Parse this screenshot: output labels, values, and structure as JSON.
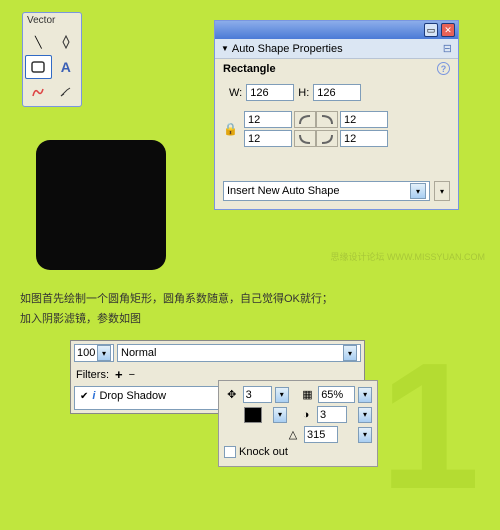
{
  "vector": {
    "title": "Vector"
  },
  "props": {
    "title": "Auto Shape Properties",
    "shape": "Rectangle",
    "w_label": "W:",
    "w": "126",
    "h_label": "H:",
    "h": "126",
    "corners": {
      "tl": "12",
      "tr": "12",
      "bl": "12",
      "br": "12"
    },
    "insert": "Insert New Auto Shape"
  },
  "watermark": "思缘设计论坛    WWW.MISSYUAN.COM",
  "instructions": {
    "line1": "如图首先绘制一个圆角矩形，圆角系数随意，自己觉得OK就行；",
    "line2": "加入阴影滤镜，参数如图"
  },
  "filter": {
    "opacity": "100",
    "blend": "Normal",
    "label": "Filters:",
    "item": "Drop Shadow"
  },
  "shadow": {
    "dist": "3",
    "opacity": "65%",
    "soft": "3",
    "angle": "315",
    "knock": "Knock out"
  },
  "bignum": "1"
}
